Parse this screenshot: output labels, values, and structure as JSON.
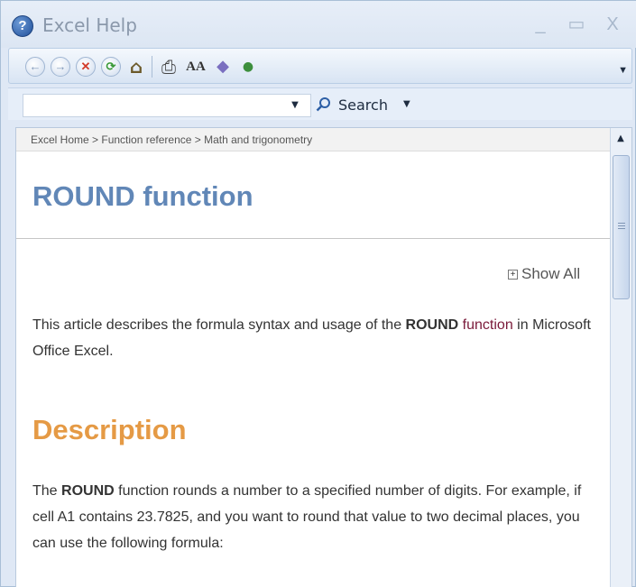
{
  "window": {
    "title": "Excel Help",
    "icon_glyph": "?",
    "minimize_glyph": "_",
    "maximize_glyph": "▭",
    "close_glyph": "X"
  },
  "toolbar": {
    "buttons": [
      {
        "name": "back-icon",
        "glyph": "←"
      },
      {
        "name": "forward-icon",
        "glyph": "→"
      },
      {
        "name": "stop-icon",
        "glyph": "✕"
      },
      {
        "name": "refresh-icon",
        "glyph": "⟳"
      },
      {
        "name": "home-icon",
        "glyph": "⌂"
      },
      {
        "name": "print-icon",
        "glyph": "⎙"
      },
      {
        "name": "text-size-icon",
        "glyph": "AA"
      },
      {
        "name": "table-of-contents-icon",
        "glyph": "◆"
      },
      {
        "name": "keep-on-top-icon",
        "glyph": "●"
      }
    ]
  },
  "search": {
    "placeholder": "",
    "button_label": "Search"
  },
  "breadcrumb": "Excel Home > Function reference > Math and trigonometry",
  "article": {
    "title": "ROUND function",
    "show_all_label": "Show All",
    "intro_before": "This article describes the formula syntax and usage of the ",
    "intro_bold": "ROUND",
    "intro_link": "function",
    "intro_after": " in Microsoft Office Excel.",
    "section_heading": "Description",
    "desc_before": "The ",
    "desc_bold": "ROUND",
    "desc_after": " function rounds a number to a specified number of digits. For example, if cell A1 contains 23.7825, and you want to round that value to two decimal places, you can use the following formula:"
  },
  "colors": {
    "title_blue": "#6187b7",
    "heading_orange": "#e59a45",
    "link_maroon": "#7a1a3a"
  }
}
